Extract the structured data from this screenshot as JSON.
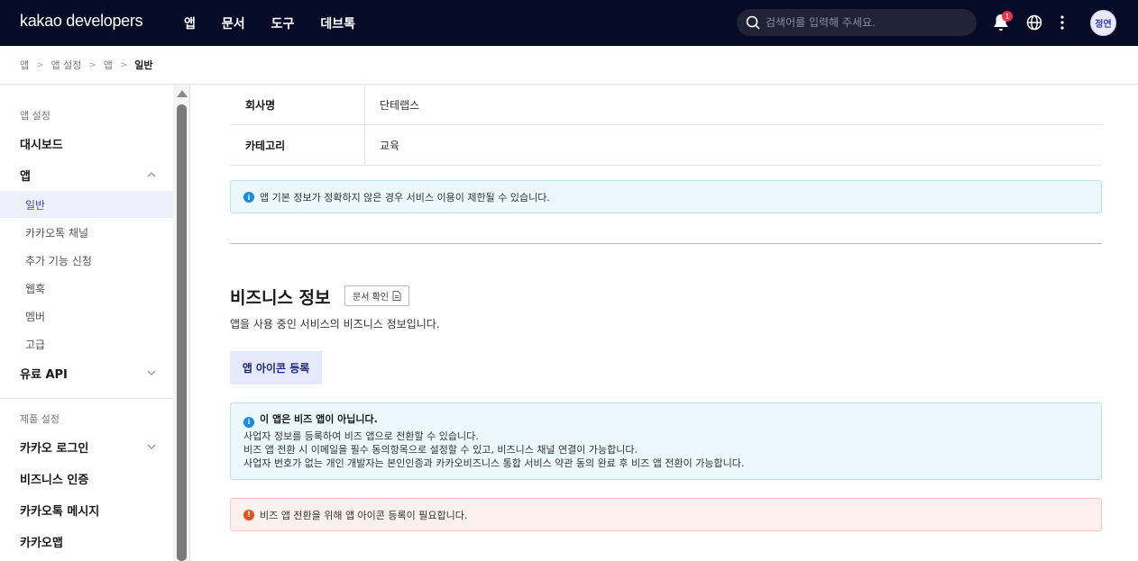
{
  "header": {
    "brand": "kakao developers",
    "nav": [
      "앱",
      "문서",
      "도구",
      "데브톡"
    ],
    "search_placeholder": "검색어를 입력해 주세요.",
    "notification_count": "1",
    "avatar_label": "정연"
  },
  "breadcrumb": [
    "앱",
    "앱 설정",
    "앱",
    "일반"
  ],
  "sidebar": {
    "section_app": "앱 설정",
    "dashboard": "대시보드",
    "app": "앱",
    "app_items": [
      "일반",
      "카카오톡 채널",
      "추가 기능 신청",
      "웹훅",
      "멤버",
      "고급"
    ],
    "paid_api": "유료 API",
    "section_product": "제품 설정",
    "kakao_login": "카카오 로그인",
    "biz_auth": "비즈니스 인증",
    "kakaotalk_msg": "카카오톡 메시지",
    "kakao_map": "카카오맵"
  },
  "main": {
    "info_rows": [
      {
        "key": "회사명",
        "value": "단테랩스"
      },
      {
        "key": "카테고리",
        "value": "교육"
      }
    ],
    "info_note": "앱 기본 정보가 정확하지 않은 경우 서비스 이용이 제한될 수 있습니다.",
    "biz_title": "비즈니스 정보",
    "doc_button": "문서 확인",
    "biz_desc": "앱을 사용 중인 서비스의 비즈니스 정보입니다.",
    "icon_button": "앱 아이콘 등록",
    "biz_note_head": "이 앱은 비즈 앱이 아닙니다.",
    "biz_note_lines": [
      "사업자 정보를 등록하여 비즈 앱으로 전환할 수 있습니다.",
      "비즈 앱 전환 시 이메일을 필수 동의항목으로 설정할 수 있고, 비즈니스 채널 연결이 가능합니다.",
      "사업자 번호가 없는 개인 개발자는 본인인증과 카카오비즈니스 통합 서비스 약관 동의 완료 후 비즈 앱 전환이 가능합니다."
    ],
    "warn_note": "비즈 앱 전환을 위해 앱 아이콘 등록이 필요합니다."
  }
}
